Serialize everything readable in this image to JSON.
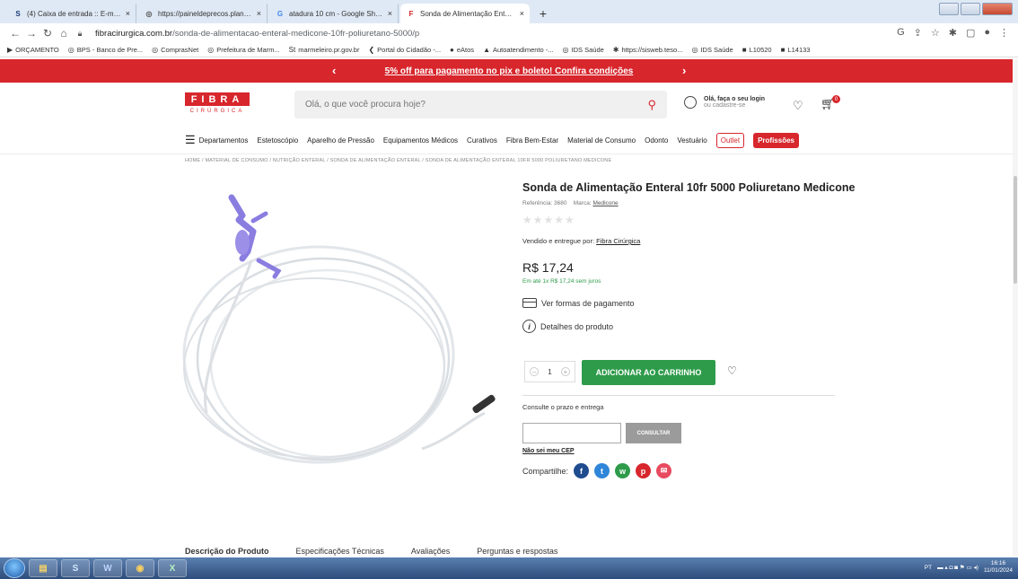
{
  "browser": {
    "tabs": [
      {
        "icon": "S",
        "icon_color": "#1a3c7a",
        "label": "(4) Caixa de entrada :: E-mail - m"
      },
      {
        "icon": "◎",
        "icon_color": "#555555",
        "label": "https://paineldeprecos.planejam"
      },
      {
        "icon": "G",
        "icon_color": "#4285f4",
        "label": "atadura 10 cm - Google Shoppin"
      },
      {
        "icon": "F",
        "icon_color": "#d7262c",
        "label": "Sonda de Alimentação Enteral M"
      }
    ],
    "url_host": "fibracirurgica.com.br",
    "url_path": "/sonda-de-alimentacao-enteral-medicone-10fr-poliuretano-5000/p",
    "bookmarks": [
      {
        "icon": "▶",
        "label": "ORÇAMENTO"
      },
      {
        "icon": "◎",
        "label": "BPS - Banco de Pre..."
      },
      {
        "icon": "◎",
        "label": "ComprasNet"
      },
      {
        "icon": "◎",
        "label": "Prefeitura de Marm..."
      },
      {
        "icon": "St",
        "label": "marmeleiro.pr.gov.br"
      },
      {
        "icon": "❮",
        "label": "Portal do Cidadão -..."
      },
      {
        "icon": "●",
        "label": "eAtos"
      },
      {
        "icon": "▲",
        "label": "Autoatendimento -..."
      },
      {
        "icon": "◎",
        "label": "IDS Saúde"
      },
      {
        "icon": "✱",
        "label": "https://sisweb.teso..."
      },
      {
        "icon": "◎",
        "label": "IDS Saúde"
      },
      {
        "icon": "■",
        "label": "L10520"
      },
      {
        "icon": "■",
        "label": "L14133"
      }
    ]
  },
  "promo": {
    "text": "5% off para pagamento no pix e boleto! Confira condições"
  },
  "header": {
    "logo_main": "FIBRA",
    "logo_sub": "CIRÚRGICA",
    "search_placeholder": "Olá, o que você procura hoje?",
    "login_line1": "Olá, faça o seu login",
    "login_line2": "ou cadastre-se",
    "cart_count": "0"
  },
  "menu": {
    "departamentos": "Departamentos",
    "items": [
      "Estetoscópio",
      "Aparelho de Pressão",
      "Equipamentos Médicos",
      "Curativos",
      "Fibra Bem-Estar",
      "Material de Consumo",
      "Odonto",
      "Vestuário"
    ],
    "outlet": "Outlet",
    "profissoes": "Profissões"
  },
  "breadcrumb": "HOME / MATERIAL DE CONSUMO / NUTRIÇÃO ENTERAL / SONDA DE ALIMENTAÇÃO ENTERAL / SONDA DE ALIMENTAÇÃO ENTERAL 10FR 5000 POLIURETANO MEDICONE",
  "product": {
    "title": "Sonda de Alimentação Enteral 10fr 5000 Poliuretano Medicone",
    "ref_label": "Referência: 3680",
    "brand_label": "Marca:",
    "brand": "Medicone",
    "rating_stars": 0,
    "sold_by_label": "Vendido e entregue por:",
    "sold_by": "Fibra Cirúrgica",
    "price": "R$ 17,24",
    "installments": "Em até 1x R$ 17,24 sem juros",
    "payment_link": "Ver formas de pagamento",
    "details_link": "Detalhes do produto",
    "quantity": "1",
    "add_to_cart": "ADICIONAR AO CARRINHO"
  },
  "shipping": {
    "label": "Consulte o prazo e entrega",
    "cep_value": "",
    "button": "CONSULTAR",
    "dont_know": "Não sei meu CEP"
  },
  "share": {
    "label": "Compartilhe:",
    "networks": [
      {
        "name": "facebook",
        "glyph": "f",
        "color": "#1f4c8f"
      },
      {
        "name": "twitter",
        "glyph": "t",
        "color": "#2f86d9"
      },
      {
        "name": "whatsapp",
        "glyph": "w",
        "color": "#2e9b4a"
      },
      {
        "name": "pinterest",
        "glyph": "p",
        "color": "#d7262c"
      },
      {
        "name": "email",
        "glyph": "✉",
        "color": "#e84a5f"
      }
    ]
  },
  "desc_tabs": [
    "Descrição do Produto",
    "Especificações Técnicas",
    "Avaliações",
    "Perguntas e respostas"
  ],
  "taskbar": {
    "lang": "PT",
    "time": "16:16",
    "date": "11/01/2024"
  },
  "colors": {
    "brand": "#d7262c",
    "buy": "#2e9b4a"
  }
}
